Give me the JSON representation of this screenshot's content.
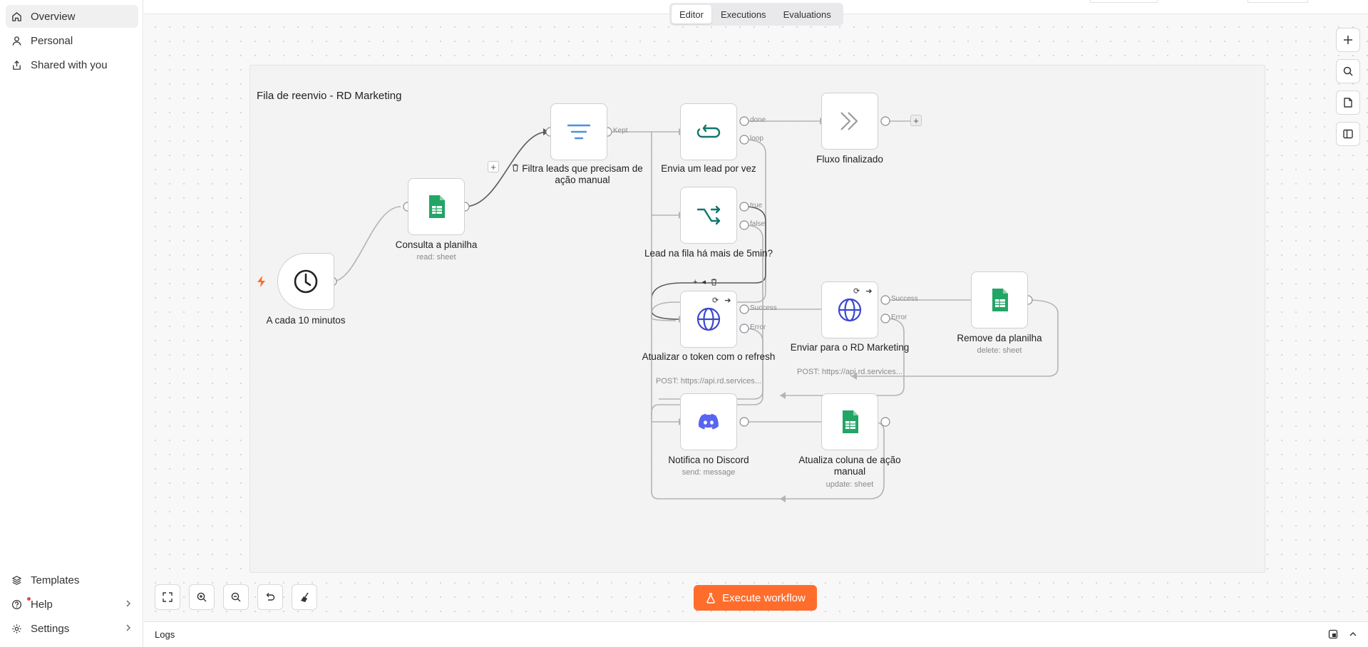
{
  "sidebar": {
    "items": [
      {
        "label": "Overview"
      },
      {
        "label": "Personal"
      },
      {
        "label": "Shared with you"
      }
    ],
    "bottom": [
      {
        "label": "Templates"
      },
      {
        "label": "Help"
      },
      {
        "label": "Settings"
      }
    ]
  },
  "tabs": [
    "Editor",
    "Executions",
    "Evaluations"
  ],
  "sticky": {
    "title": "Fila de reenvio - RD Marketing"
  },
  "nodes": {
    "trigger": {
      "label": "A cada 10 minutos"
    },
    "sheet_read": {
      "label": "Consulta a planilha",
      "sub": "read: sheet"
    },
    "filter": {
      "label": "Filtra leads que precisam de ação manual"
    },
    "loop": {
      "label": "Envia um lead por vez"
    },
    "done": {
      "label": "Fluxo finalizado"
    },
    "if": {
      "label": "Lead na fila há mais de 5min?"
    },
    "refresh": {
      "label": "Atualizar o token com o refresh",
      "sub": "POST: https://api.rd.services..."
    },
    "send_rd": {
      "label": "Enviar para o RD Marketing",
      "sub": "POST: https://api.rd.services..."
    },
    "remove": {
      "label": "Remove da planilha",
      "sub": "delete: sheet"
    },
    "discord": {
      "label": "Notifica no Discord",
      "sub": "send: message"
    },
    "update": {
      "label": "Atualiza coluna de ação manual",
      "sub": "update: sheet"
    }
  },
  "ports": {
    "kept": "Kept",
    "done": "done",
    "loop": "loop",
    "true": "true",
    "false": "false",
    "success1": "Success",
    "error1": "Error",
    "success2": "Success",
    "error2": "Error"
  },
  "execute": {
    "label": "Execute workflow"
  },
  "logs": {
    "label": "Logs"
  },
  "colors": {
    "accent": "#ff6d2d",
    "sheets": "#23a566",
    "teal": "#0f766e",
    "globe": "#3b48cc",
    "discord": "#5865f2"
  }
}
